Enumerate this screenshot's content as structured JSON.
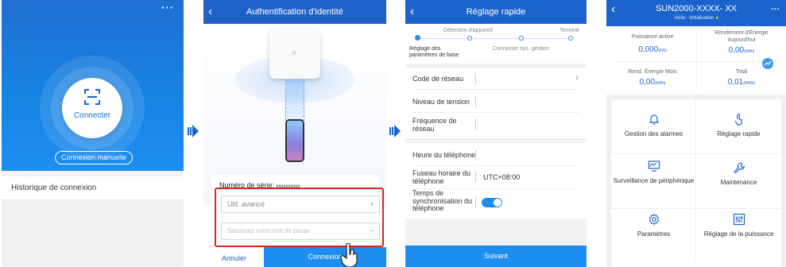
{
  "screen1": {
    "menu_icon": "more-dots",
    "connect_label": "Connecter",
    "manual_connection_label": "Connexion manuelle",
    "history_label": "Historique de connexion"
  },
  "screen2": {
    "title": "Authentification d'identité",
    "serial_label": "Numéro de série:",
    "serial_value": "xxxxxxxxxx",
    "user_select_value": "Util. avancé",
    "password_placeholder": "Saisissez votre mot de passe",
    "cancel_label": "Annuler",
    "login_label": "Connexion",
    "highlight_color": "#e02424"
  },
  "screen3": {
    "title": "Réglage rapide",
    "steps_top": [
      "Détection d'appareil",
      "Terminé"
    ],
    "steps_bottom": [
      "Réglage des paramètres de base",
      "Connecter sys. gestion"
    ],
    "fields": {
      "grid_code": "Code de réseau",
      "voltage_level": "Niveau de tension",
      "frequency": "Fréquence de réseau",
      "phone_time": "Heure du téléphone",
      "timezone": "Fuseau horaire du téléphone",
      "timezone_value": "UTC+08:00",
      "time_sync": "Temps de synchronisation du téléphone"
    },
    "next_label": "Suivant"
  },
  "screen4": {
    "title": "SUN2000-XXXX- XX",
    "status_prefix": "Veille : initialisation",
    "status_dot": "●",
    "stats": [
      {
        "label": "Puissance active",
        "value": "0,000",
        "unit": "(kW)"
      },
      {
        "label": "Rendement d'Énergie Aujourd'hui",
        "value": "0,00",
        "unit": "(kWh)"
      },
      {
        "label": "Rend. Énergie Mois",
        "value": "0,00",
        "unit": "(kWh)"
      },
      {
        "label": "Total",
        "value": "0,01",
        "unit": "(MWh)"
      }
    ],
    "tiles": [
      {
        "label": "Gestion des alarmes",
        "icon": "bell-icon"
      },
      {
        "label": "Réglage rapide",
        "icon": "touch-icon"
      },
      {
        "label": "Surveillance de périphérique",
        "icon": "monitor-icon"
      },
      {
        "label": "Maintenance",
        "icon": "wrench-icon"
      },
      {
        "label": "Paramètres",
        "icon": "gear-icon"
      },
      {
        "label": "Réglage de la puissance",
        "icon": "sliders-icon"
      }
    ],
    "accent": "#1b63cc"
  }
}
